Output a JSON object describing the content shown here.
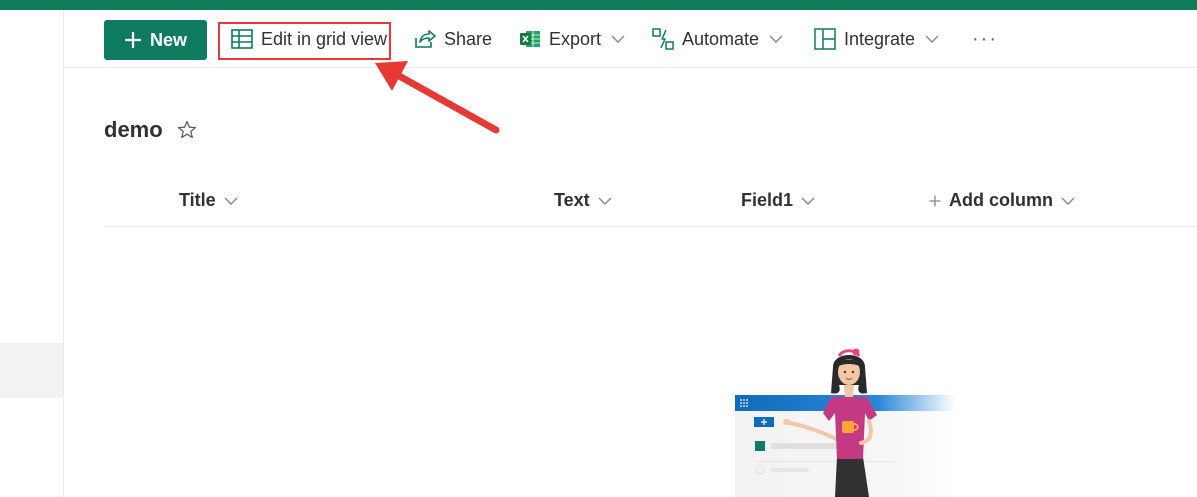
{
  "theme": {
    "accent": "#0f7b5e",
    "suite_bar": "#107c5a",
    "highlight_border": "#e53935",
    "arrow": "#e53935"
  },
  "command_bar": {
    "new_label": "New",
    "edit_grid_label": "Edit in grid view",
    "share_label": "Share",
    "export_label": "Export",
    "automate_label": "Automate",
    "integrate_label": "Integrate",
    "more_label": "···",
    "icons": {
      "new": "plus-icon",
      "edit_grid": "grid-icon",
      "share": "share-icon",
      "export": "excel-icon",
      "automate": "flow-icon",
      "integrate": "integrate-icon"
    }
  },
  "list": {
    "name": "demo",
    "favorite_icon": "star-outline-icon"
  },
  "columns": {
    "title": "Title",
    "text": "Text",
    "field1": "Field1",
    "add_column": "Add column"
  }
}
